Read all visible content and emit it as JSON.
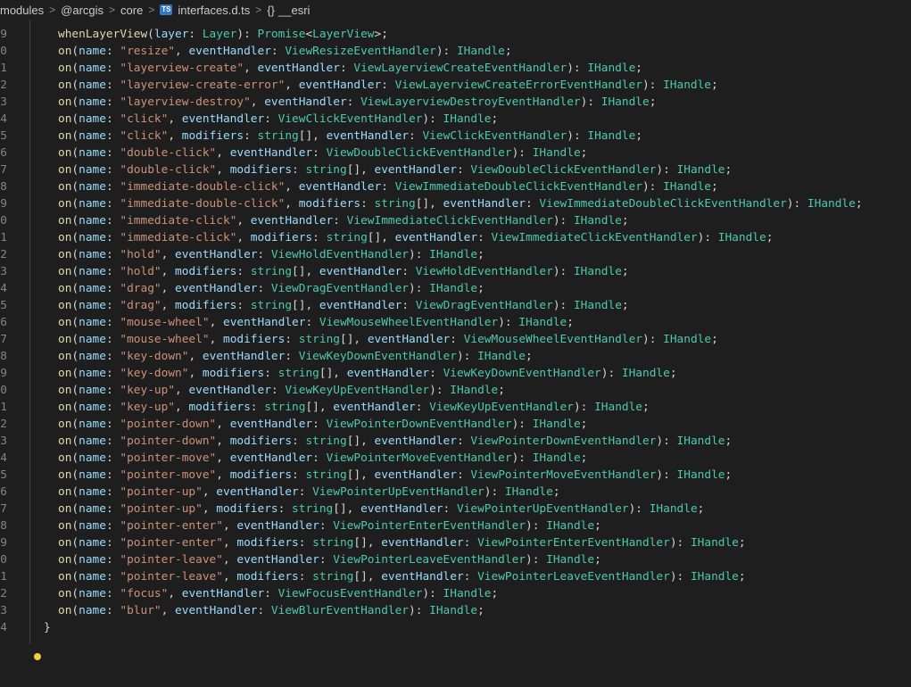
{
  "breadcrumb": {
    "items": [
      "modules",
      "@arcgis",
      "core",
      "interfaces.d.ts",
      "__esri"
    ],
    "ts_badge": "TS",
    "braces": "{}"
  },
  "editor": {
    "first_line": {
      "ln": "9",
      "fn": "whenLayerView",
      "param": "layer",
      "type": "Layer",
      "ret": "Promise",
      "ret_type": "LayerView"
    },
    "lines": [
      {
        "ln": "0",
        "event": "\"resize\"",
        "mods": false,
        "handler": "ViewResizeEventHandler"
      },
      {
        "ln": "1",
        "event": "\"layerview-create\"",
        "mods": false,
        "handler": "ViewLayerviewCreateEventHandler"
      },
      {
        "ln": "2",
        "event": "\"layerview-create-error\"",
        "mods": false,
        "handler": "ViewLayerviewCreateErrorEventHandler"
      },
      {
        "ln": "3",
        "event": "\"layerview-destroy\"",
        "mods": false,
        "handler": "ViewLayerviewDestroyEventHandler"
      },
      {
        "ln": "4",
        "event": "\"click\"",
        "mods": false,
        "handler": "ViewClickEventHandler"
      },
      {
        "ln": "5",
        "event": "\"click\"",
        "mods": true,
        "handler": "ViewClickEventHandler"
      },
      {
        "ln": "6",
        "event": "\"double-click\"",
        "mods": false,
        "handler": "ViewDoubleClickEventHandler"
      },
      {
        "ln": "7",
        "event": "\"double-click\"",
        "mods": true,
        "handler": "ViewDoubleClickEventHandler"
      },
      {
        "ln": "8",
        "event": "\"immediate-double-click\"",
        "mods": false,
        "handler": "ViewImmediateDoubleClickEventHandler"
      },
      {
        "ln": "9",
        "event": "\"immediate-double-click\"",
        "mods": true,
        "handler": "ViewImmediateDoubleClickEventHandler"
      },
      {
        "ln": "0",
        "event": "\"immediate-click\"",
        "mods": false,
        "handler": "ViewImmediateClickEventHandler"
      },
      {
        "ln": "1",
        "event": "\"immediate-click\"",
        "mods": true,
        "handler": "ViewImmediateClickEventHandler"
      },
      {
        "ln": "2",
        "event": "\"hold\"",
        "mods": false,
        "handler": "ViewHoldEventHandler"
      },
      {
        "ln": "3",
        "event": "\"hold\"",
        "mods": true,
        "handler": "ViewHoldEventHandler"
      },
      {
        "ln": "4",
        "event": "\"drag\"",
        "mods": false,
        "handler": "ViewDragEventHandler"
      },
      {
        "ln": "5",
        "event": "\"drag\"",
        "mods": true,
        "handler": "ViewDragEventHandler"
      },
      {
        "ln": "6",
        "event": "\"mouse-wheel\"",
        "mods": false,
        "handler": "ViewMouseWheelEventHandler"
      },
      {
        "ln": "7",
        "event": "\"mouse-wheel\"",
        "mods": true,
        "handler": "ViewMouseWheelEventHandler"
      },
      {
        "ln": "8",
        "event": "\"key-down\"",
        "mods": false,
        "handler": "ViewKeyDownEventHandler"
      },
      {
        "ln": "9",
        "event": "\"key-down\"",
        "mods": true,
        "handler": "ViewKeyDownEventHandler"
      },
      {
        "ln": "0",
        "event": "\"key-up\"",
        "mods": false,
        "handler": "ViewKeyUpEventHandler"
      },
      {
        "ln": "1",
        "event": "\"key-up\"",
        "mods": true,
        "handler": "ViewKeyUpEventHandler"
      },
      {
        "ln": "2",
        "event": "\"pointer-down\"",
        "mods": false,
        "handler": "ViewPointerDownEventHandler"
      },
      {
        "ln": "3",
        "event": "\"pointer-down\"",
        "mods": true,
        "handler": "ViewPointerDownEventHandler"
      },
      {
        "ln": "4",
        "event": "\"pointer-move\"",
        "mods": false,
        "handler": "ViewPointerMoveEventHandler"
      },
      {
        "ln": "5",
        "event": "\"pointer-move\"",
        "mods": true,
        "handler": "ViewPointerMoveEventHandler"
      },
      {
        "ln": "6",
        "event": "\"pointer-up\"",
        "mods": false,
        "handler": "ViewPointerUpEventHandler"
      },
      {
        "ln": "7",
        "event": "\"pointer-up\"",
        "mods": true,
        "handler": "ViewPointerUpEventHandler"
      },
      {
        "ln": "8",
        "event": "\"pointer-enter\"",
        "mods": false,
        "handler": "ViewPointerEnterEventHandler"
      },
      {
        "ln": "9",
        "event": "\"pointer-enter\"",
        "mods": true,
        "handler": "ViewPointerEnterEventHandler"
      },
      {
        "ln": "0",
        "event": "\"pointer-leave\"",
        "mods": false,
        "handler": "ViewPointerLeaveEventHandler"
      },
      {
        "ln": "1",
        "event": "\"pointer-leave\"",
        "mods": true,
        "handler": "ViewPointerLeaveEventHandler"
      },
      {
        "ln": "2",
        "event": "\"focus\"",
        "mods": false,
        "handler": "ViewFocusEventHandler"
      },
      {
        "ln": "3",
        "event": "\"blur\"",
        "mods": false,
        "handler": "ViewBlurEventHandler"
      }
    ],
    "last_line": {
      "ln": "4",
      "text": "}"
    },
    "tokens": {
      "on": "on",
      "name": "name",
      "eventHandler": "eventHandler",
      "modifiers": "modifiers",
      "string_type": "string",
      "return_type": "IHandle"
    }
  }
}
